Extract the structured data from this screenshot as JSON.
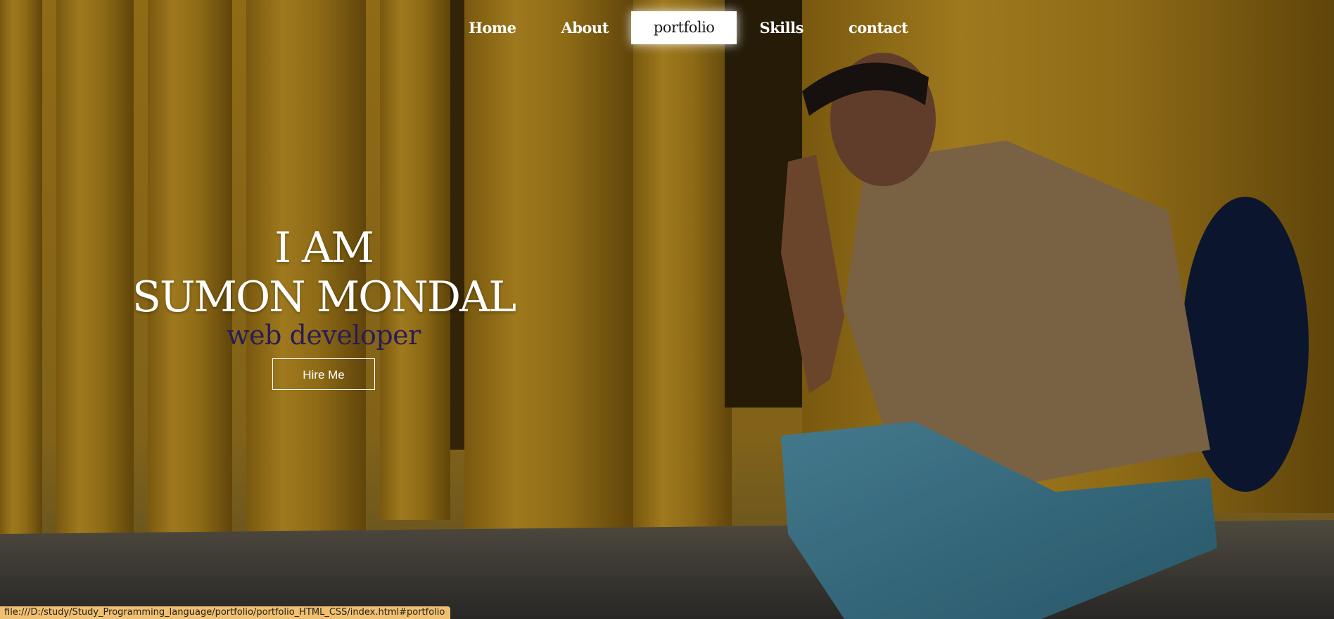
{
  "nav": {
    "items": [
      {
        "label": "Home",
        "active": false
      },
      {
        "label": "About",
        "active": false
      },
      {
        "label": "portfolio",
        "active": true
      },
      {
        "label": "Skills",
        "active": false
      },
      {
        "label": "contact",
        "active": false
      }
    ]
  },
  "hero": {
    "line1": "I AM",
    "line2": "SUMON MONDAL",
    "role": "web developer",
    "cta_label": "Hire Me"
  },
  "status_bar": {
    "url": "file:///D:/study/Study_Programming_language/portfolio/portfolio_HTML_CSS/index.html#portfolio"
  },
  "colors": {
    "background_wall": "#a57c1c",
    "role_text": "#2a1d55",
    "status_bar": "#f0c070"
  }
}
